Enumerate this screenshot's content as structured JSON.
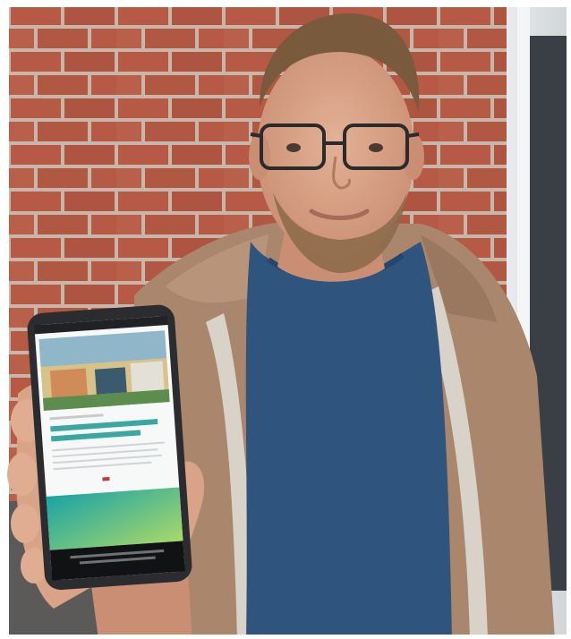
{
  "photo": {
    "subject": "man-holding-smartphone",
    "phone_screen": {
      "header_line": "",
      "headline": "",
      "body_lines": [],
      "footer_caption": ""
    },
    "colors": {
      "brick": "#b65a45",
      "mortar": "#c9b6a8",
      "jacket": "#a9866c",
      "shirt": "#2f557f",
      "skin": "#d9a387",
      "hair": "#7a5a3c",
      "phone_frame": "#2a2c30",
      "screen_accent": "#3fb8a9"
    }
  }
}
